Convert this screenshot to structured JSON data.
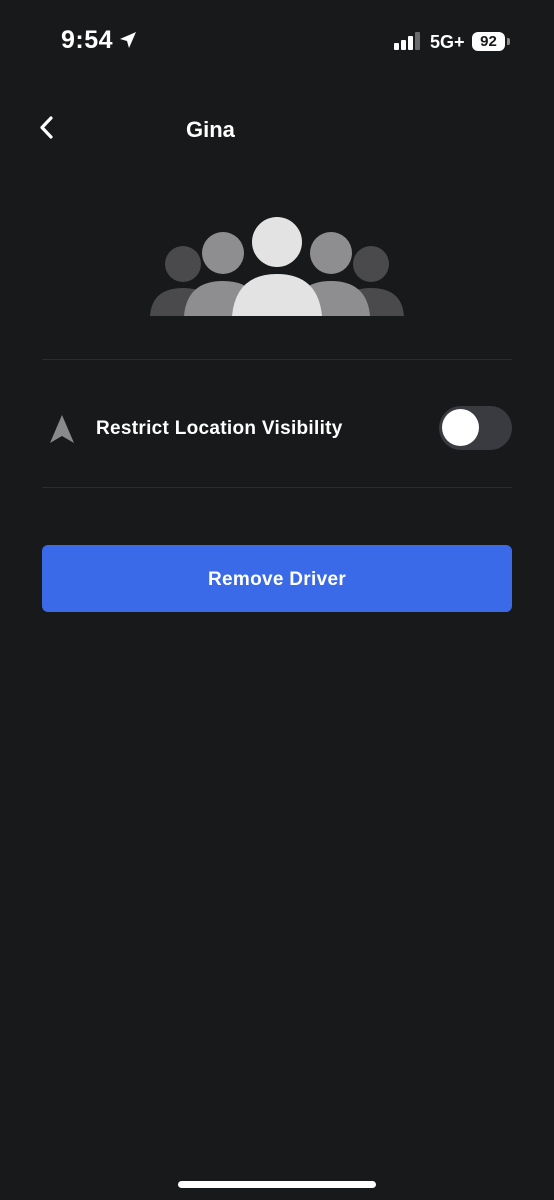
{
  "status_bar": {
    "time": "9:54",
    "network": "5G+",
    "battery": "92"
  },
  "header": {
    "title": "Gina"
  },
  "settings": {
    "restrict_location_label": "Restrict Location Visibility",
    "restrict_location_enabled": false
  },
  "actions": {
    "remove_driver_label": "Remove Driver"
  },
  "colors": {
    "background": "#18191b",
    "accent": "#3a6ae8",
    "toggle_off": "#3a3b40"
  },
  "icons": {
    "back": "chevron-left-icon",
    "location_arrow": "location-arrow-icon",
    "navigation": "navigation-arrow-icon",
    "group": "people-group-icon"
  }
}
